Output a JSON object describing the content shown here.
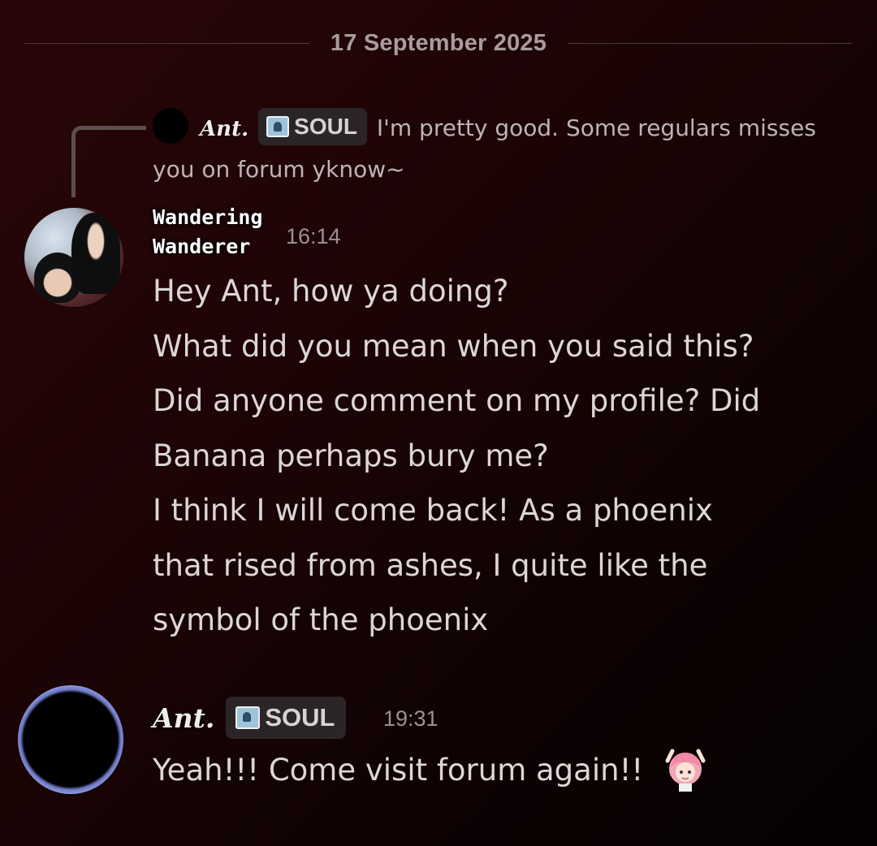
{
  "date_divider": "17 September 2025",
  "reply": {
    "author": "Ant.",
    "tag": "SOUL",
    "tag_icon": "tag-badge-icon",
    "text": "I'm pretty good. Some regulars misses you on forum yknow~"
  },
  "messages": [
    {
      "author_line1": "Wandering",
      "author_line2": "Wanderer",
      "timestamp": "16:14",
      "lines": [
        "Hey Ant, how ya doing?",
        "What did you mean when you said this?",
        "Did anyone comment on my profile? Did",
        "Banana perhaps bury me?",
        "I think I will come back! As a phoenix",
        "that rised from ashes, I quite like the",
        "symbol of the phoenix"
      ]
    },
    {
      "author": "Ant.",
      "tag": "SOUL",
      "timestamp": "19:31",
      "text": "Yeah!!! Come visit forum again!!",
      "emoji": "pink-hair-anime-girl-emoji"
    }
  ],
  "colors": {
    "background_start": "#2a0608",
    "background_end": "#050101",
    "text": "#dcd6d6",
    "muted": "#9c9293",
    "tag_bg": "#2c2527"
  }
}
